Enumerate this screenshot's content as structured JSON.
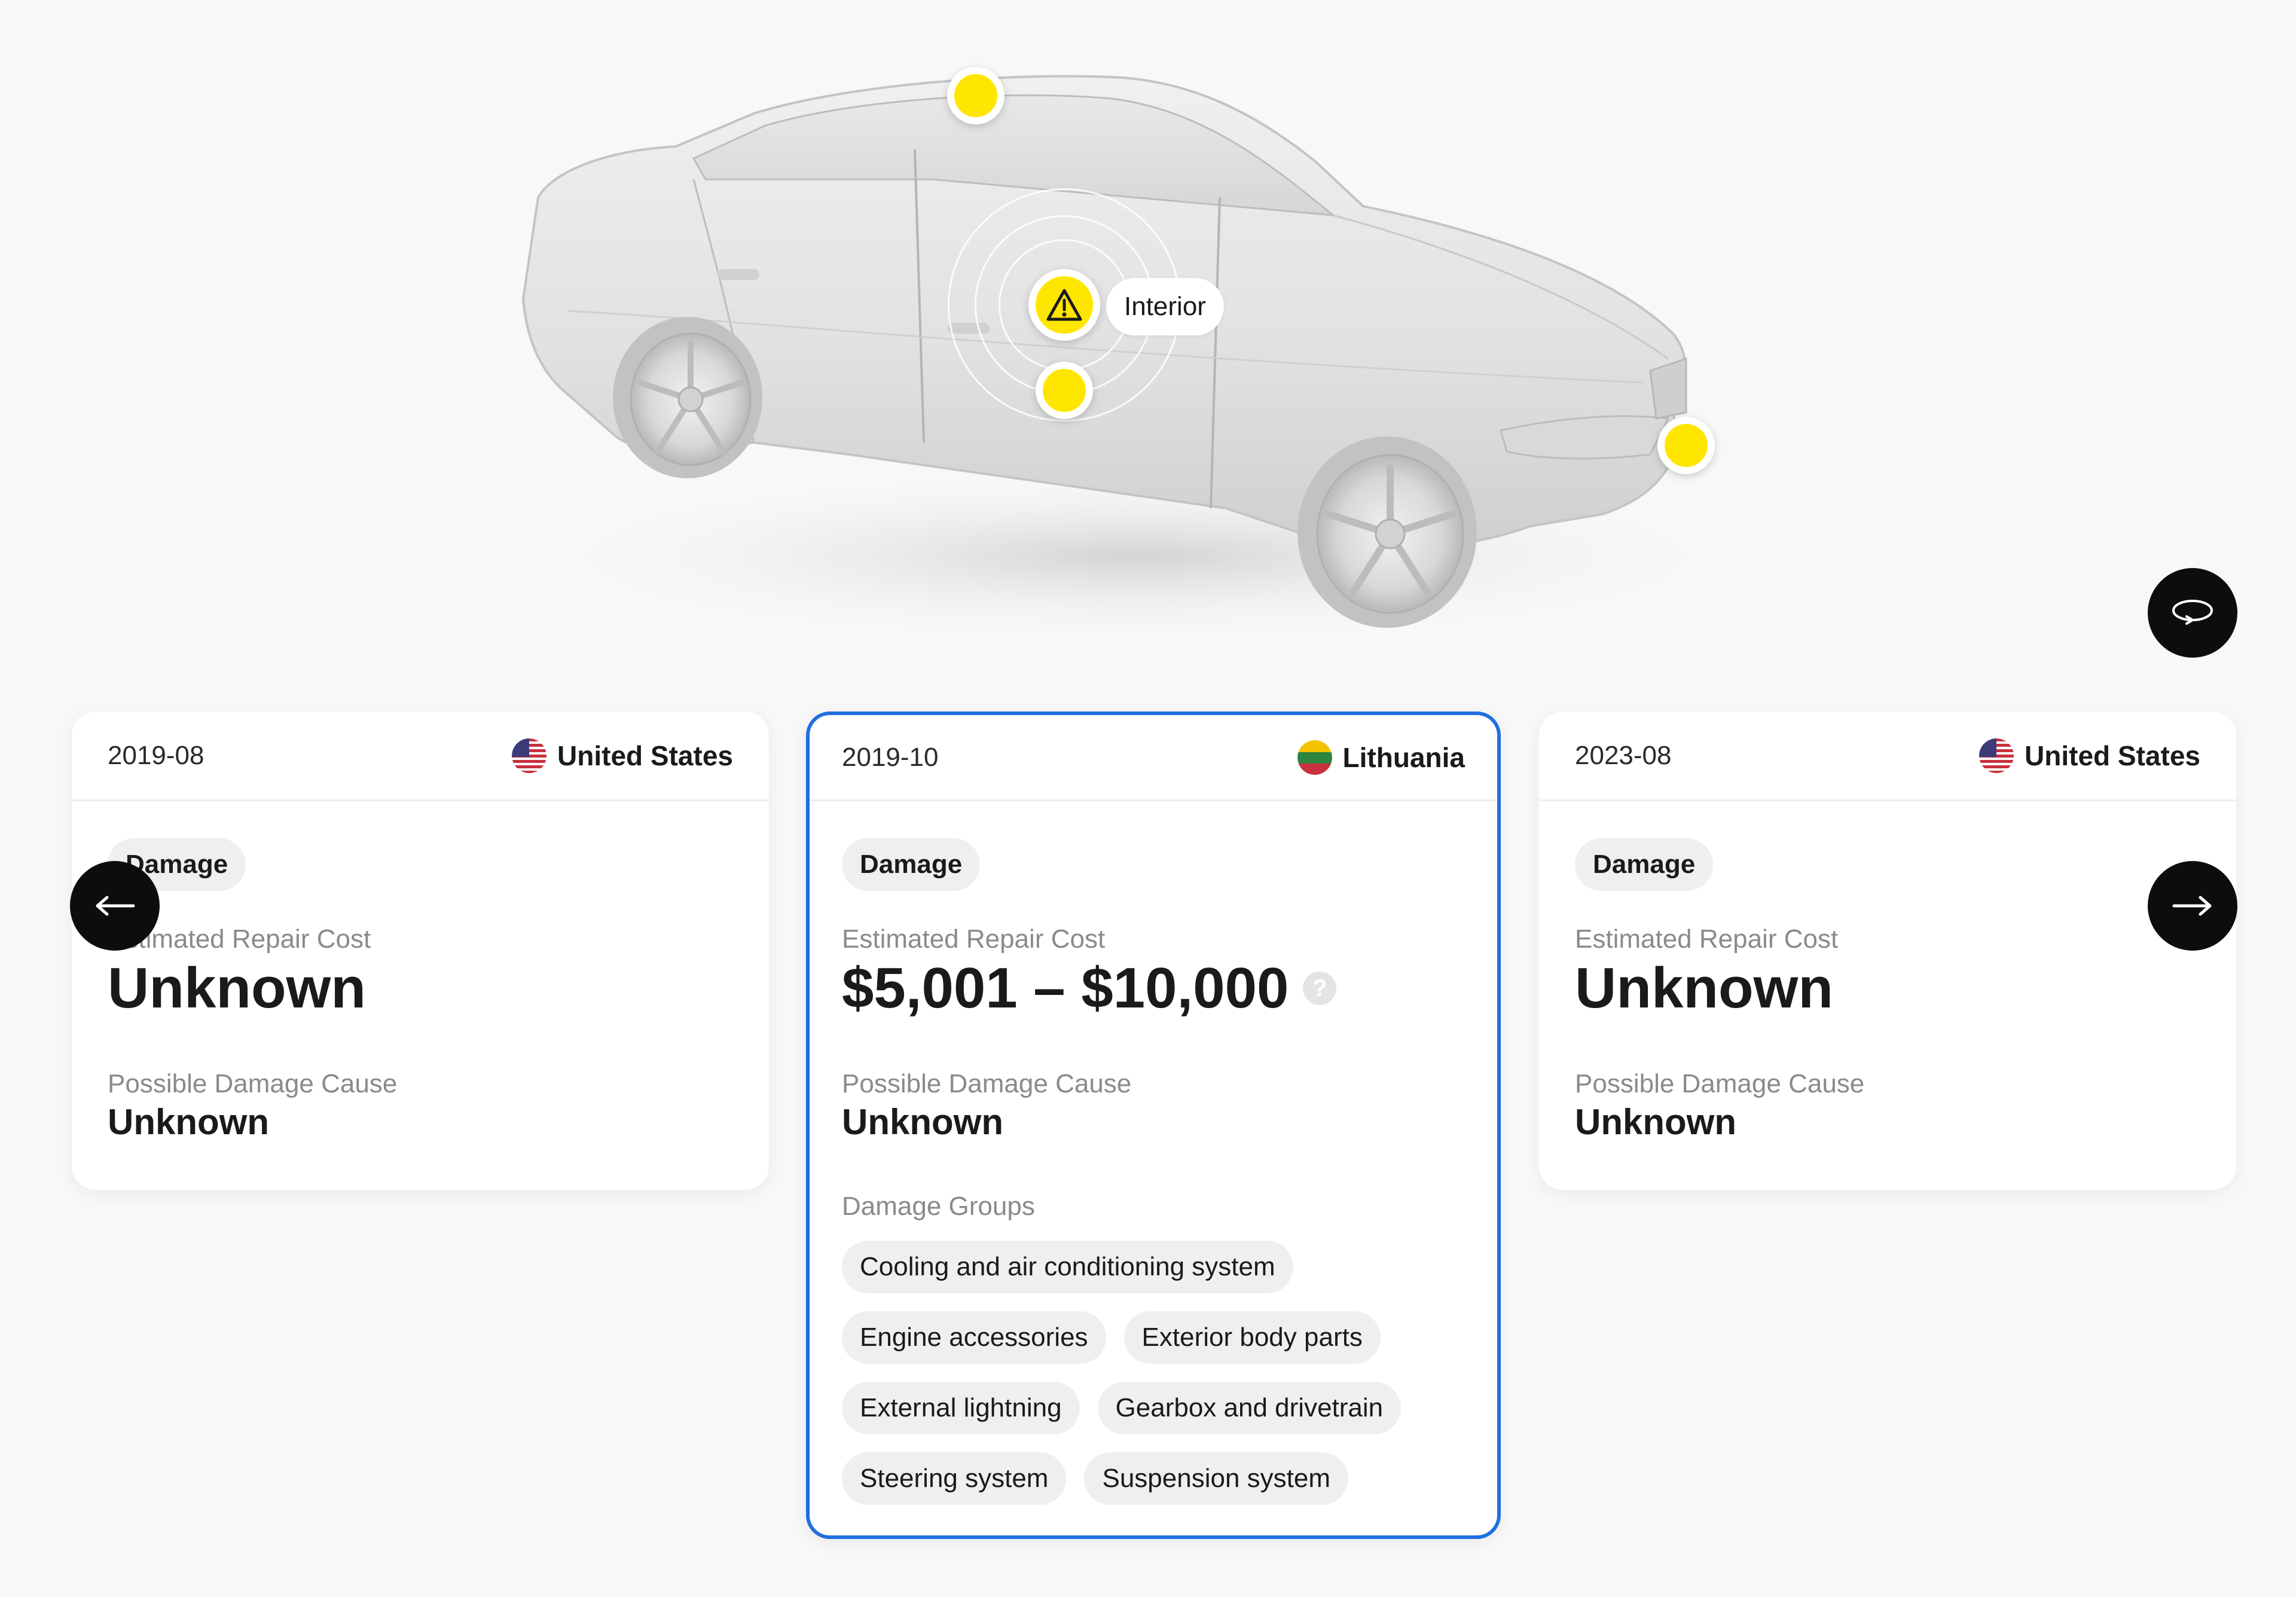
{
  "car": {
    "hotspot_label": "Interior",
    "hotspots": [
      "roof",
      "interior",
      "door",
      "front-bumper"
    ]
  },
  "colors": {
    "hotspot": "#ffe600",
    "selected_border": "#1f6fe0",
    "button_bg": "#0d0d0d"
  },
  "controls": {
    "rotate_icon": "rotate-icon",
    "prev_icon": "arrow-left-icon",
    "next_icon": "arrow-right-icon"
  },
  "cards": [
    {
      "date": "2019-08",
      "country": "United States",
      "flag": "us-flag-icon",
      "badge": "Damage",
      "cost_label": "Estimated Repair Cost",
      "cost": "Unknown",
      "cause_label": "Possible Damage Cause",
      "cause": "Unknown"
    },
    {
      "date": "2019-10",
      "country": "Lithuania",
      "flag": "lt-flag-icon",
      "badge": "Damage",
      "cost_label": "Estimated Repair Cost",
      "cost": "$5,001 – $10,000",
      "help": "?",
      "cause_label": "Possible Damage Cause",
      "cause": "Unknown",
      "groups_label": "Damage Groups",
      "groups": [
        "Cooling and air conditioning system",
        "Engine accessories",
        "Exterior body parts",
        "External lightning",
        "Gearbox and drivetrain",
        "Steering system",
        "Suspension system"
      ]
    },
    {
      "date": "2023-08",
      "country": "United States",
      "flag": "us-flag-icon",
      "badge": "Damage",
      "cost_label": "Estimated Repair Cost",
      "cost": "Unknown",
      "cause_label": "Possible Damage Cause",
      "cause": "Unknown"
    }
  ]
}
